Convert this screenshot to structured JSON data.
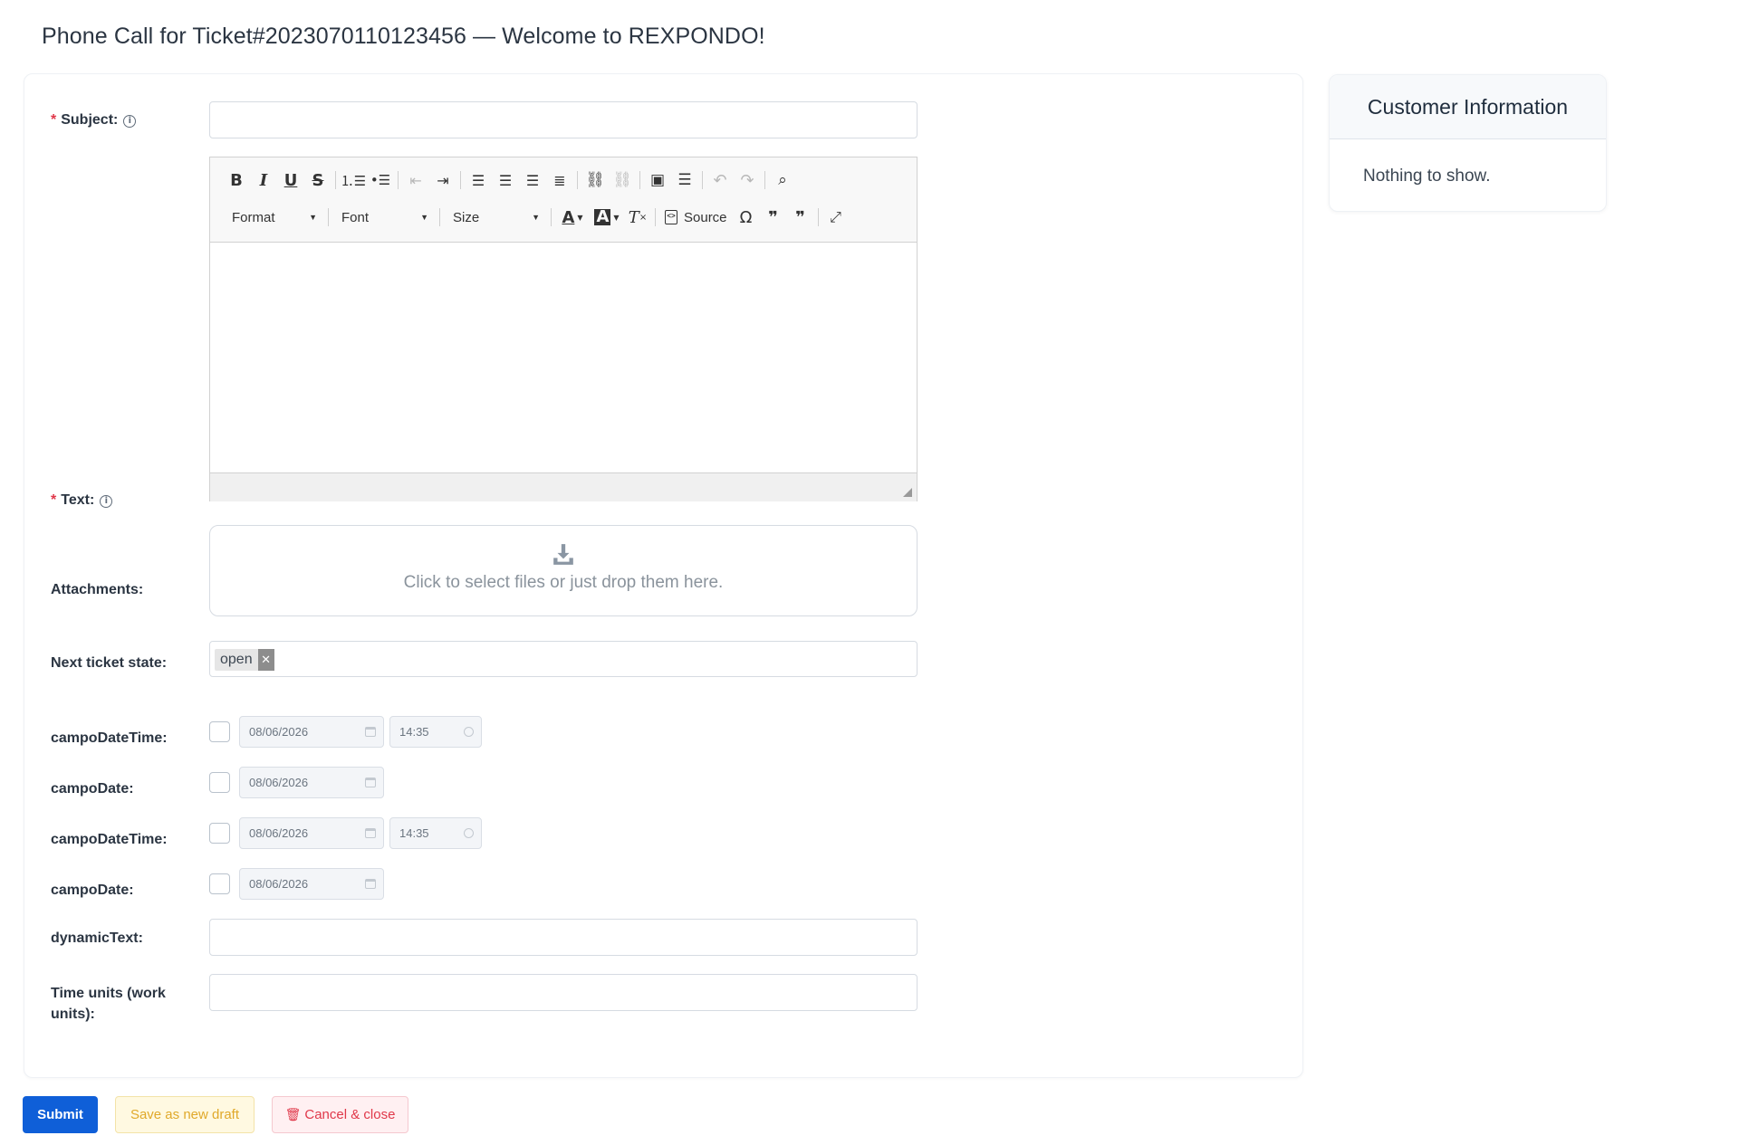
{
  "page": {
    "title": "Phone Call for Ticket#2023070110123456 — Welcome to REXPONDO!"
  },
  "form": {
    "subject": {
      "label": "Subject:",
      "value": ""
    },
    "text": {
      "label": "Text:"
    },
    "editor": {
      "toolbar_row1_icons": [
        "bold-icon",
        "italic-icon",
        "underline-icon",
        "strikethrough-icon",
        "numbered-list-icon",
        "bulleted-list-icon",
        "outdent-icon",
        "indent-icon",
        "align-left-icon",
        "align-center-icon",
        "align-right-icon",
        "justify-icon",
        "link-icon",
        "unlink-icon",
        "image-icon",
        "horizontal-line-icon",
        "undo-icon",
        "redo-icon",
        "find-icon"
      ],
      "format_label": "Format",
      "font_label": "Font",
      "size_label": "Size",
      "source_label": "Source"
    },
    "attachments": {
      "label": "Attachments:",
      "dropzone_text": "Click to select files or just drop them here."
    },
    "next_state": {
      "label": "Next ticket state:",
      "selected": "open"
    },
    "date_fields": [
      {
        "label": "campoDateTime:",
        "date": "08/06/2026",
        "time": "14:35"
      },
      {
        "label": "campoDate:",
        "date": "08/06/2026"
      },
      {
        "label": "campoDateTime:",
        "date": "08/06/2026",
        "time": "14:35"
      },
      {
        "label": "campoDate:",
        "date": "08/06/2026"
      }
    ],
    "dynamic_text": {
      "label": "dynamicText:",
      "value": ""
    },
    "time_units": {
      "label": "Time units (work units):",
      "value": ""
    }
  },
  "buttons": {
    "submit": "Submit",
    "save_draft": "Save as new draft",
    "cancel": "Cancel & close"
  },
  "customer_info": {
    "title": "Customer Information",
    "empty_text": "Nothing to show."
  },
  "colors": {
    "primary": "#0f5fd8",
    "required": "#e0384a",
    "draft": "#e0a92a"
  }
}
